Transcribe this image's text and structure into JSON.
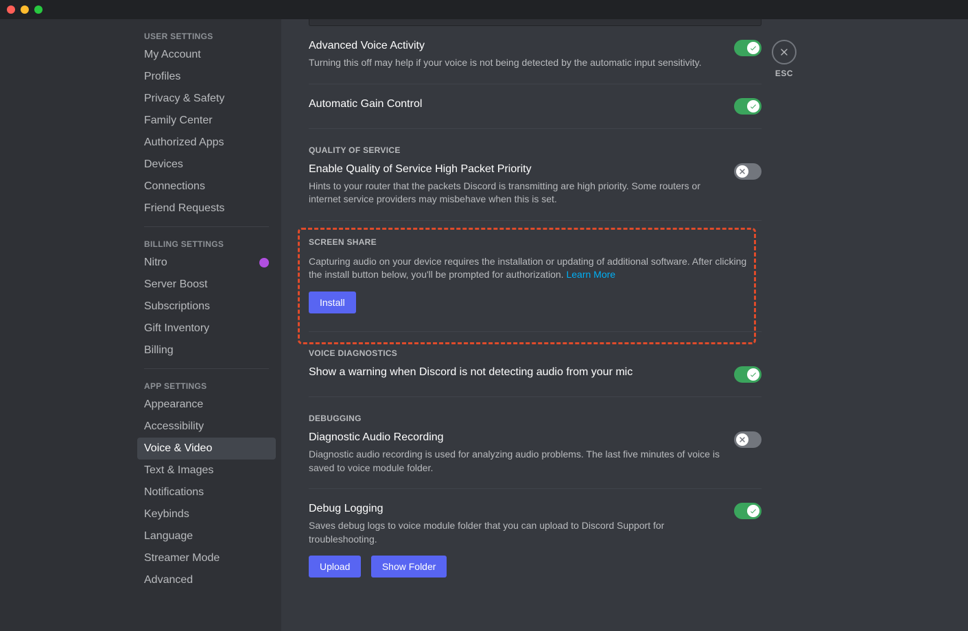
{
  "titlebar": {
    "close": "",
    "min": "",
    "max": ""
  },
  "close": {
    "esc_label": "ESC"
  },
  "sidebar": {
    "sections": [
      {
        "header": "USER SETTINGS",
        "items": [
          {
            "label": "My Account",
            "active": false
          },
          {
            "label": "Profiles",
            "active": false
          },
          {
            "label": "Privacy & Safety",
            "active": false
          },
          {
            "label": "Family Center",
            "active": false
          },
          {
            "label": "Authorized Apps",
            "active": false
          },
          {
            "label": "Devices",
            "active": false
          },
          {
            "label": "Connections",
            "active": false
          },
          {
            "label": "Friend Requests",
            "active": false
          }
        ]
      },
      {
        "header": "BILLING SETTINGS",
        "items": [
          {
            "label": "Nitro",
            "active": false,
            "badge": true
          },
          {
            "label": "Server Boost",
            "active": false
          },
          {
            "label": "Subscriptions",
            "active": false
          },
          {
            "label": "Gift Inventory",
            "active": false
          },
          {
            "label": "Billing",
            "active": false
          }
        ]
      },
      {
        "header": "APP SETTINGS",
        "items": [
          {
            "label": "Appearance",
            "active": false
          },
          {
            "label": "Accessibility",
            "active": false
          },
          {
            "label": "Voice & Video",
            "active": true
          },
          {
            "label": "Text & Images",
            "active": false
          },
          {
            "label": "Notifications",
            "active": false
          },
          {
            "label": "Keybinds",
            "active": false
          },
          {
            "label": "Language",
            "active": false
          },
          {
            "label": "Streamer Mode",
            "active": false
          },
          {
            "label": "Advanced",
            "active": false
          }
        ]
      }
    ]
  },
  "content": {
    "advanced_voice": {
      "title": "Advanced Voice Activity",
      "desc": "Turning this off may help if your voice is not being detected by the automatic input sensitivity.",
      "on": true
    },
    "auto_gain": {
      "title": "Automatic Gain Control",
      "on": true
    },
    "qos": {
      "heading": "QUALITY OF SERVICE",
      "title": "Enable Quality of Service High Packet Priority",
      "desc": "Hints to your router that the packets Discord is transmitting are high priority. Some routers or internet service providers may misbehave when this is set.",
      "on": false
    },
    "screenshare": {
      "heading": "SCREEN SHARE",
      "desc": "Capturing audio on your device requires the installation or updating of additional software. After clicking the install button below, you'll be prompted for authorization. ",
      "learn_more": "Learn More",
      "install_btn": "Install"
    },
    "voice_diag": {
      "heading": "VOICE DIAGNOSTICS",
      "title": "Show a warning when Discord is not detecting audio from your mic",
      "on": true
    },
    "debugging": {
      "heading": "DEBUGGING",
      "dar_title": "Diagnostic Audio Recording",
      "dar_desc": "Diagnostic audio recording is used for analyzing audio problems. The last five minutes of voice is saved to voice module folder.",
      "dar_on": false,
      "dl_title": "Debug Logging",
      "dl_desc": "Saves debug logs to voice module folder that you can upload to Discord Support for troubleshooting.",
      "dl_on": true,
      "upload_btn": "Upload",
      "showfolder_btn": "Show Folder"
    }
  }
}
